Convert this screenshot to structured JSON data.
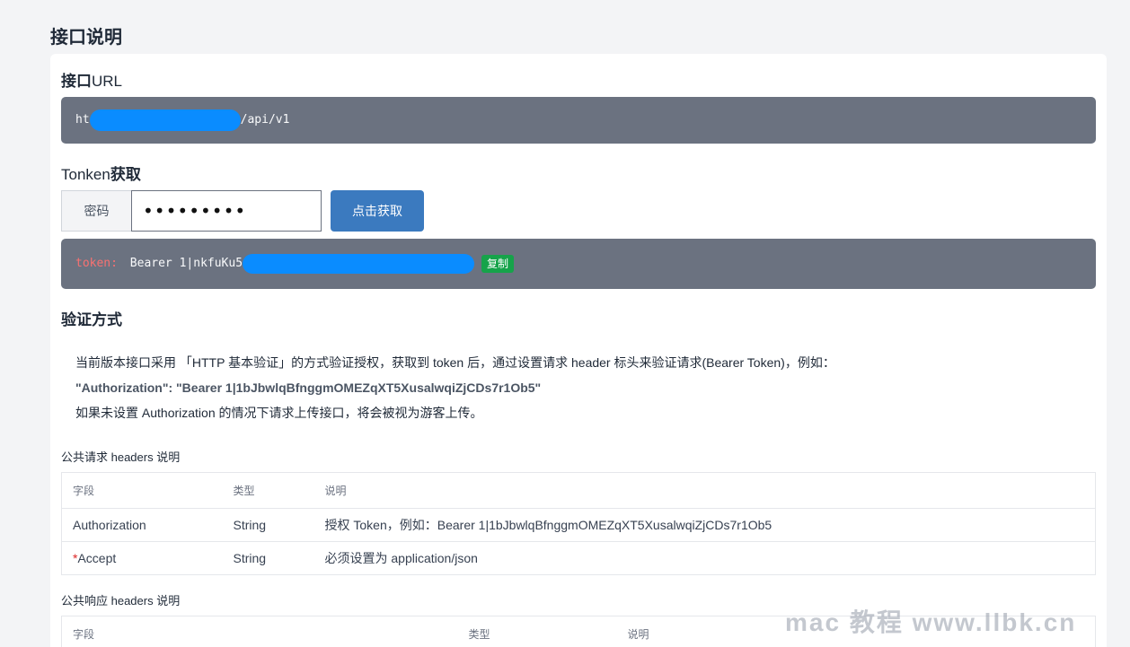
{
  "page_title": "接口说明",
  "url_section": {
    "title_cn": "接口",
    "title_en": "URL",
    "url_prefix": "ht",
    "url_suffix": "/api/v1"
  },
  "token_section": {
    "title_en": "Tonken",
    "title_cn": "获取",
    "password_label": "密码",
    "password_value": "•••••••••",
    "get_button": "点击获取",
    "token_key": "token:",
    "token_value": "Bearer 1|nkfuKu5",
    "copy_label": "复制"
  },
  "auth_section": {
    "title": "验证方式",
    "line1": "当前版本接口采用 「HTTP 基本验证」的方式验证授权，获取到 token 后，通过设置请求 header 标头来验证请求(Bearer Token)，例如：",
    "line2": "\"Authorization\": \"Bearer 1|1bJbwlqBfnggmOMEZqXT5XusalwqiZjCDs7r1Ob5\"",
    "line3": "如果未设置 Authorization 的情况下请求上传接口，将会被视为游客上传。"
  },
  "request_headers": {
    "title": "公共请求 headers 说明",
    "columns": [
      "字段",
      "类型",
      "说明"
    ],
    "rows": [
      {
        "field": "Authorization",
        "required": false,
        "type": "String",
        "desc": "授权 Token，例如：Bearer 1|1bJbwlqBfnggmOMEZqXT5XusalwqiZjCDs7r1Ob5"
      },
      {
        "field": "Accept",
        "required": true,
        "type": "String",
        "desc": "必须设置为 application/json"
      }
    ]
  },
  "response_headers": {
    "title": "公共响应 headers 说明",
    "columns": [
      "字段",
      "类型",
      "说明"
    ]
  },
  "watermark": "mac 教程 www.llbk.cn",
  "colors": {
    "code_bg": "#6b7280",
    "redaction": "#0a8cff",
    "button": "#3b7abf",
    "copy_badge": "#16a34a",
    "token_key": "#f87171"
  }
}
